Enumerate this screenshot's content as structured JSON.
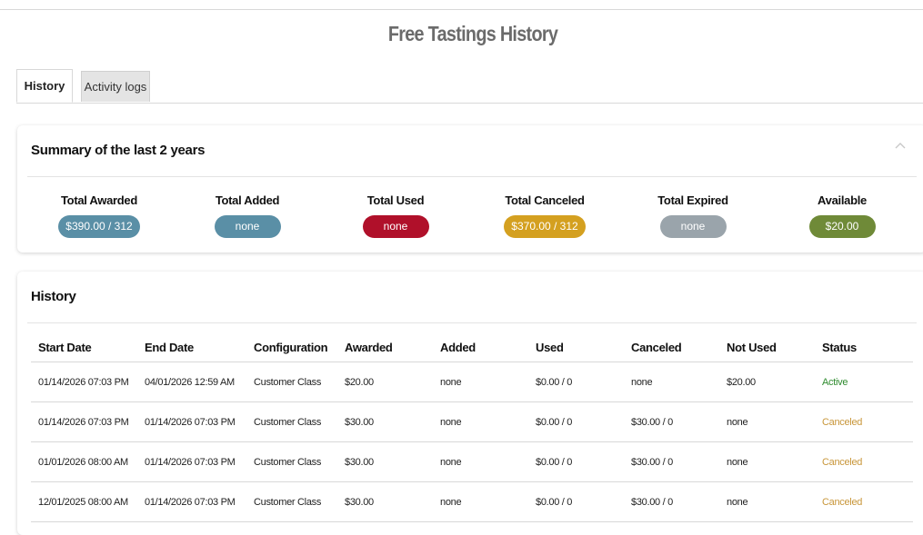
{
  "page": {
    "title": "Free Tastings History"
  },
  "tabs": [
    {
      "label": "History",
      "active": true
    },
    {
      "label": "Activity logs",
      "active": false
    }
  ],
  "summary": {
    "title": "Summary of the last 2 years",
    "stats": [
      {
        "label": "Total Awarded",
        "value": "$390.00 / 312",
        "color": "#5a8fa6"
      },
      {
        "label": "Total Added",
        "value": "none",
        "color": "#5a8fa6"
      },
      {
        "label": "Total Used",
        "value": "none",
        "color": "#b0102a"
      },
      {
        "label": "Total Canceled",
        "value": "$370.00 / 312",
        "color": "#d4a020"
      },
      {
        "label": "Total Expired",
        "value": "none",
        "color": "#9aa4ab"
      },
      {
        "label": "Available",
        "value": "$20.00",
        "color": "#6f8a38"
      }
    ]
  },
  "history": {
    "title": "History",
    "columns": [
      "Start Date",
      "End Date",
      "Configuration",
      "Awarded",
      "Added",
      "Used",
      "Canceled",
      "Not Used",
      "Status"
    ],
    "rows": [
      [
        "01/14/2026 07:03 PM",
        "04/01/2026 12:59 AM",
        "Customer Class",
        "$20.00",
        "none",
        "$0.00 / 0",
        "none",
        "$20.00",
        "Active"
      ],
      [
        "01/14/2026 07:03 PM",
        "01/14/2026 07:03 PM",
        "Customer Class",
        "$30.00",
        "none",
        "$0.00 / 0",
        "$30.00 / 0",
        "none",
        "Canceled"
      ],
      [
        "01/01/2026 08:00 AM",
        "01/14/2026 07:03 PM",
        "Customer Class",
        "$30.00",
        "none",
        "$0.00 / 0",
        "$30.00 / 0",
        "none",
        "Canceled"
      ],
      [
        "12/01/2025 08:00 AM",
        "01/14/2026 07:03 PM",
        "Customer Class",
        "$30.00",
        "none",
        "$0.00 / 0",
        "$30.00 / 0",
        "none",
        "Canceled"
      ]
    ]
  },
  "colors": {
    "active": "#2e8b2e",
    "canceled": "#c8963a"
  },
  "icons": {
    "collapse": "chevron-up-icon"
  }
}
